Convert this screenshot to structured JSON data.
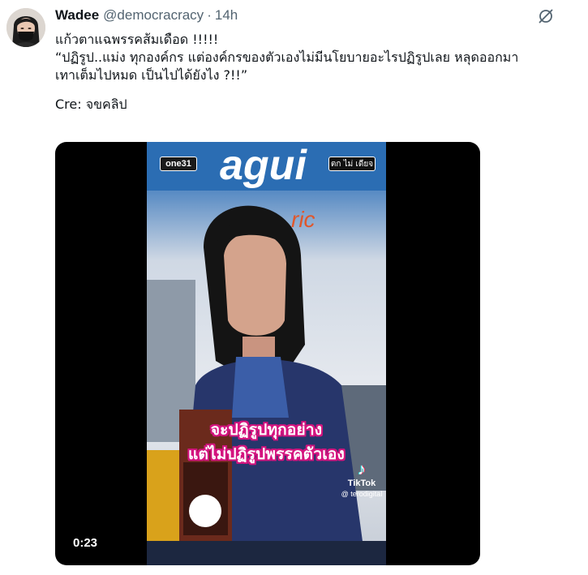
{
  "author": {
    "name": "Wadee",
    "handle": "@democracracy",
    "separator": "·",
    "time": "14h"
  },
  "tweet": {
    "lines": [
      "แก้วตาแฉพรรคส้มเดือด !!!!!",
      "“ปฏิรูป..แม่ง ทุกองค์กร แต่องค์กรของตัวเองไม่มีนโยบายอะไรปฏิรูปเลย หลุดออกมา",
      "เทาเต็มไปหมด เป็นไปได้ยังไง ?!!”"
    ],
    "credit": "Cre: จขคลิป"
  },
  "media": {
    "duration": "0:23",
    "channel_logo": "one31",
    "show_logo": "ตก ไม่ เดียจ",
    "caption_line1": "จะปฏิรูปทุกอย่าง",
    "caption_line2": "แต่ไม่ปฏิรูปพรรคตัวเอง",
    "background_text_1": "agui",
    "background_text_2": "ric",
    "watermark_app": "TikTok",
    "watermark_user": "@ terodigital"
  },
  "icons": {
    "more": "grok-slash-icon"
  },
  "colors": {
    "text_primary": "#0f1419",
    "text_secondary": "#536471",
    "caption_outline": "#d4147f"
  }
}
